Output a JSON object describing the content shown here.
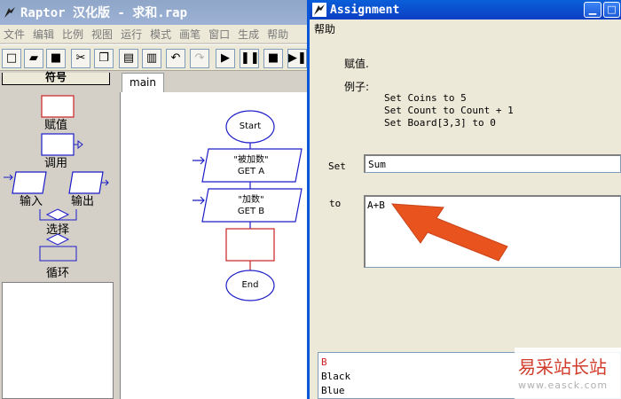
{
  "main_window": {
    "title": "Raptor 汉化版 - 求和.rap",
    "menu": [
      "文件",
      "编辑",
      "比例",
      "视图",
      "运行",
      "模式",
      "画笔",
      "窗口",
      "生成",
      "帮助"
    ],
    "symbols_title": "符号",
    "symbols": {
      "assignment": "赋值",
      "call": "调用",
      "input": "输入",
      "output": "输出",
      "selection": "选择",
      "loop": "循环"
    },
    "tab": "main",
    "flowchart": {
      "start": "Start",
      "input1_prompt": "\"被加数\"",
      "input1_get": "GET A",
      "input2_prompt": "\"加数\"",
      "input2_get": "GET B",
      "end": "End"
    }
  },
  "dialog": {
    "title": "Assignment",
    "menu": "帮助",
    "heading": "赋值.",
    "example_title": "例子:",
    "examples": [
      "Set Coins to 5",
      "Set Count to Count + 1",
      "Set Board[3,3] to 0"
    ],
    "set_label": "Set",
    "set_value": "Sum",
    "to_label": "to",
    "to_value": "A+B",
    "suggestions": [
      "B",
      "Black",
      "Blue"
    ]
  },
  "watermark": {
    "name": "易采站长站",
    "url": "www.easck.com"
  },
  "colors": {
    "title_active": "#0b4fd0",
    "title_inactive": "#9db2d4",
    "arrow": "#e8531e",
    "flow_blue": "#1c1cc8",
    "flow_red": "#cc2222"
  }
}
